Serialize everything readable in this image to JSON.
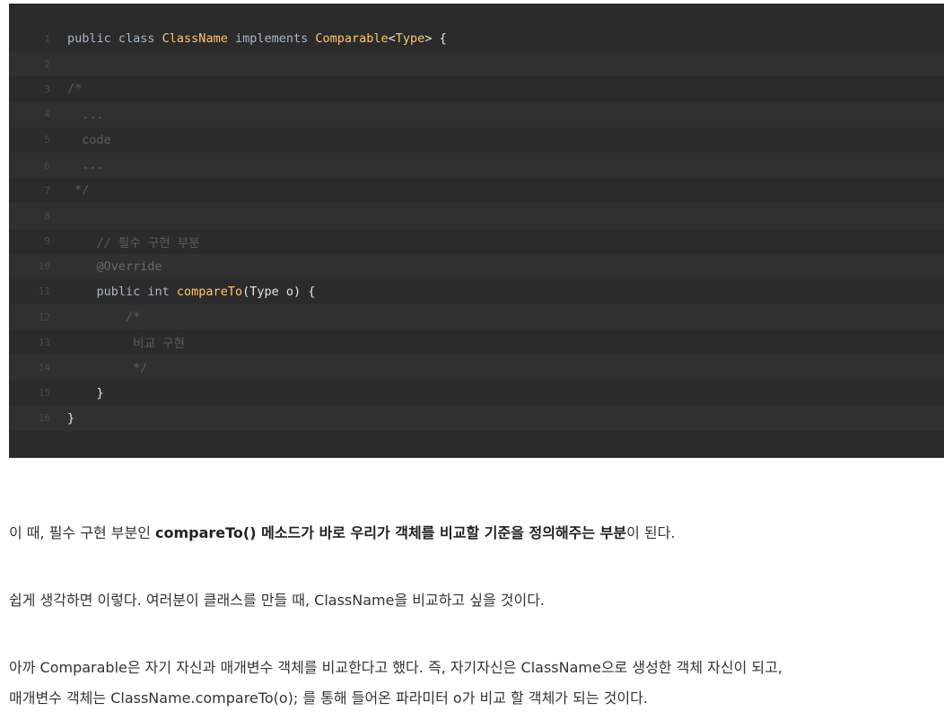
{
  "code": {
    "lines": [
      {
        "num": "1",
        "tokens": [
          {
            "t": "public class ",
            "c": "kw"
          },
          {
            "t": "ClassName",
            "c": "class"
          },
          {
            "t": " implements ",
            "c": "kw"
          },
          {
            "t": "Comparable",
            "c": "class"
          },
          {
            "t": "<",
            "c": "plain"
          },
          {
            "t": "Type",
            "c": "class"
          },
          {
            "t": "> {",
            "c": "plain"
          }
        ]
      },
      {
        "num": "2",
        "tokens": []
      },
      {
        "num": "3",
        "tokens": [
          {
            "t": "/*",
            "c": "comment"
          }
        ]
      },
      {
        "num": "4",
        "tokens": [
          {
            "t": "  ...",
            "c": "comment"
          }
        ]
      },
      {
        "num": "5",
        "tokens": [
          {
            "t": "  code",
            "c": "comment"
          }
        ]
      },
      {
        "num": "6",
        "tokens": [
          {
            "t": "  ...",
            "c": "comment"
          }
        ]
      },
      {
        "num": "7",
        "tokens": [
          {
            "t": " */",
            "c": "comment"
          }
        ]
      },
      {
        "num": "8",
        "tokens": []
      },
      {
        "num": "9",
        "tokens": [
          {
            "t": "    // 필수 구현 부분",
            "c": "comment"
          }
        ]
      },
      {
        "num": "10",
        "tokens": [
          {
            "t": "    @Override",
            "c": "anno"
          }
        ]
      },
      {
        "num": "11",
        "tokens": [
          {
            "t": "    public int ",
            "c": "kw"
          },
          {
            "t": "compareTo",
            "c": "method"
          },
          {
            "t": "(Type o) {",
            "c": "plain"
          }
        ]
      },
      {
        "num": "12",
        "tokens": [
          {
            "t": "        /*",
            "c": "comment"
          }
        ]
      },
      {
        "num": "13",
        "tokens": [
          {
            "t": "         비교 구현",
            "c": "comment"
          }
        ]
      },
      {
        "num": "14",
        "tokens": [
          {
            "t": "         */",
            "c": "comment"
          }
        ]
      },
      {
        "num": "15",
        "tokens": [
          {
            "t": "    }",
            "c": "plain"
          }
        ]
      },
      {
        "num": "16",
        "tokens": [
          {
            "t": "}",
            "c": "plain"
          }
        ]
      }
    ]
  },
  "paragraphs": {
    "p1_pre": "이 때, 필수 구현 부분인 ",
    "p1_bold": "compareTo() 메소드가 바로 우리가 객체를 비교할 기준을 정의해주는 부분",
    "p1_post": "이 된다.",
    "p2": "쉽게 생각하면 이렇다. 여러분이 클래스를 만들 때, ClassName을 비교하고 싶을 것이다.",
    "p3_line1": "아까 Comparable은 자기 자신과 매개변수 객체를 비교한다고 했다. 즉, 자기자신은 ClassName으로 생성한 객체 자신이 되고,",
    "p3_line2": "매개변수 객체는 ClassName.compareTo(o); 를 통해 들어온 파라미터 o가 비교 할 객체가 되는 것이다."
  }
}
